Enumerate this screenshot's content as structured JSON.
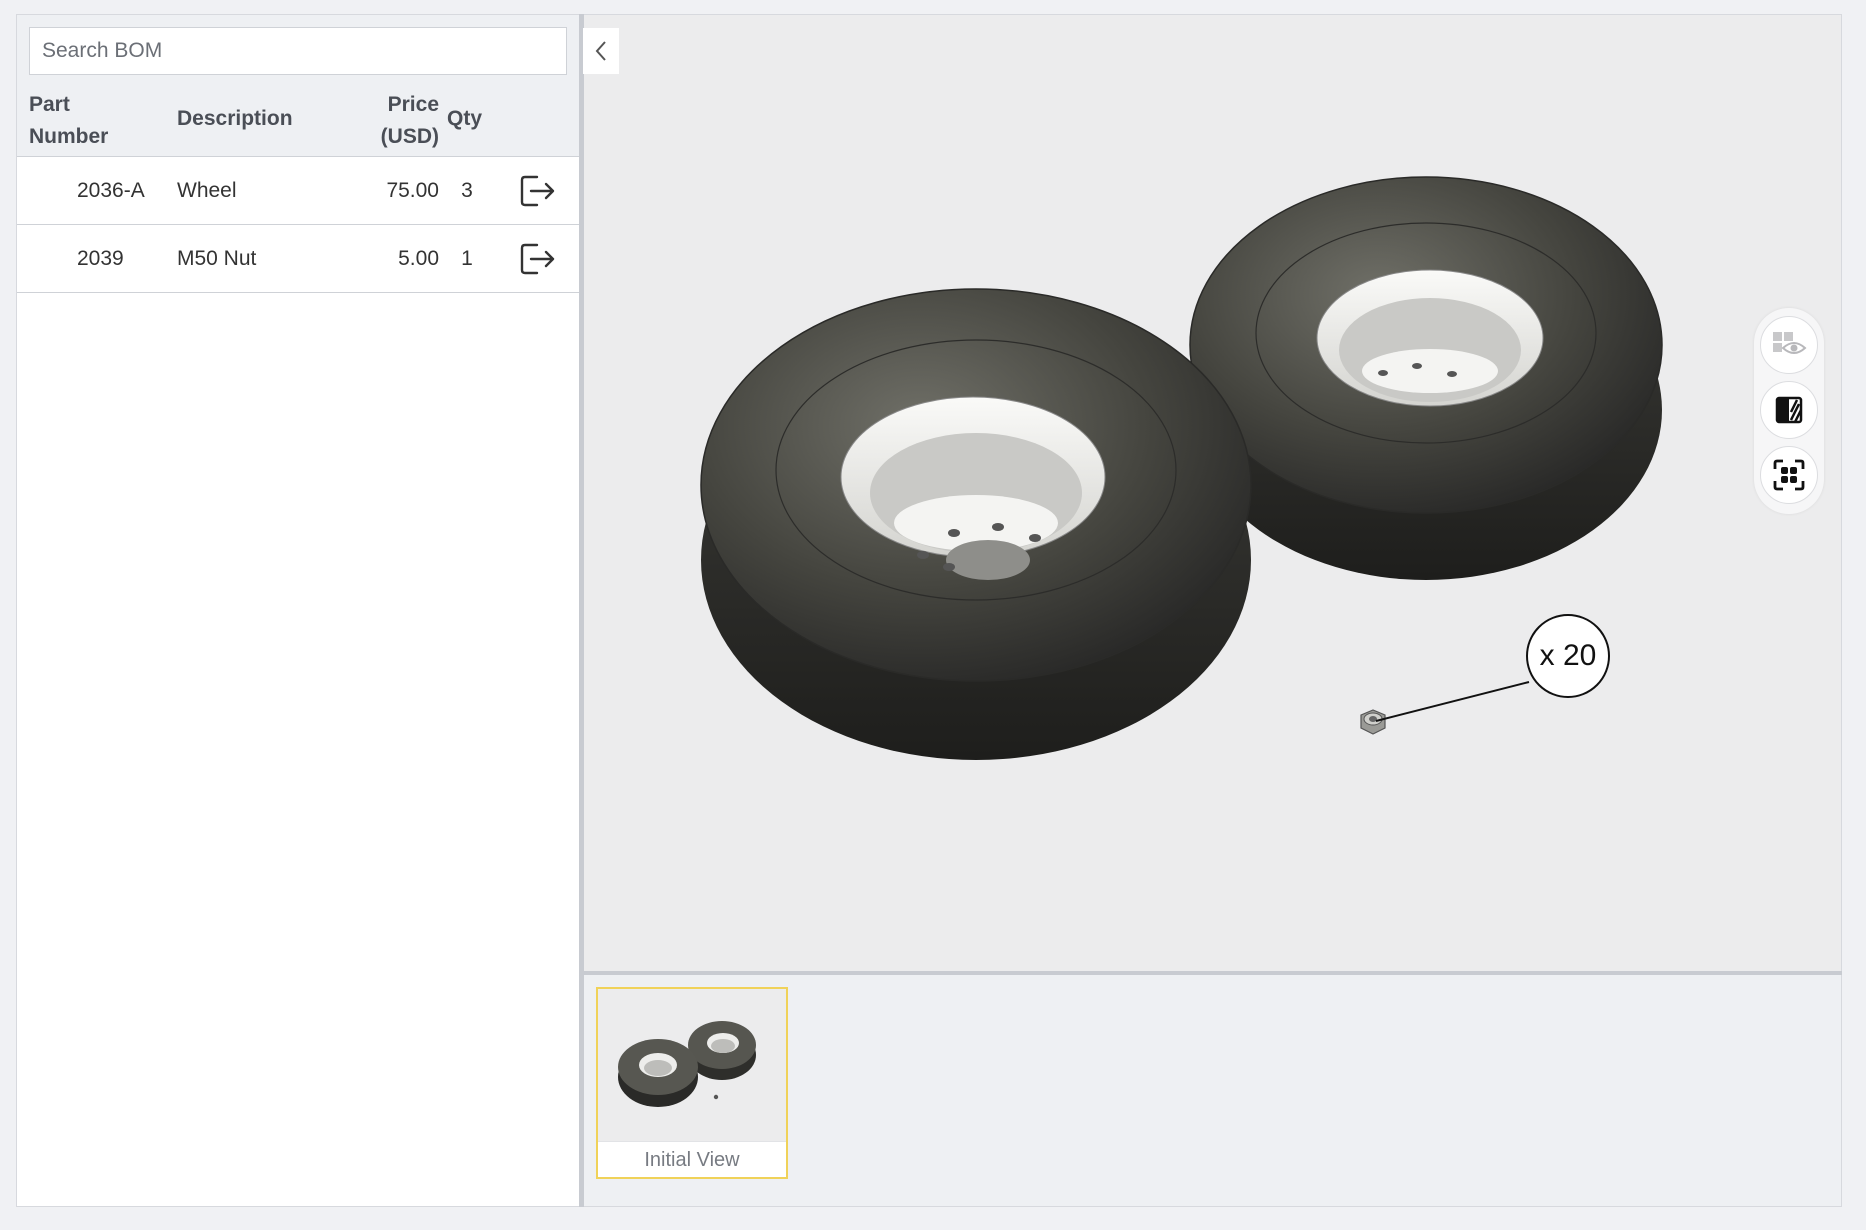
{
  "bom": {
    "search_placeholder": "Search BOM",
    "headers": {
      "part_number": "Part Number",
      "description": "Description",
      "price": "Price (USD)",
      "qty": "Qty"
    },
    "rows": [
      {
        "part_number": "2036-A",
        "description": "Wheel",
        "price": "75.00",
        "qty": "3"
      },
      {
        "part_number": "2039",
        "description": "M50 Nut",
        "price": "5.00",
        "qty": "1"
      }
    ]
  },
  "viewer": {
    "callout_label": "x 20",
    "tools": [
      "visibility-icon",
      "contrast-icon",
      "focus-icon"
    ]
  },
  "views": [
    {
      "label": "Initial View",
      "selected": true
    }
  ],
  "colors": {
    "selected_border": "#f0d259",
    "viewer_background": "#ececed",
    "panel_background": "#eef0f3"
  }
}
